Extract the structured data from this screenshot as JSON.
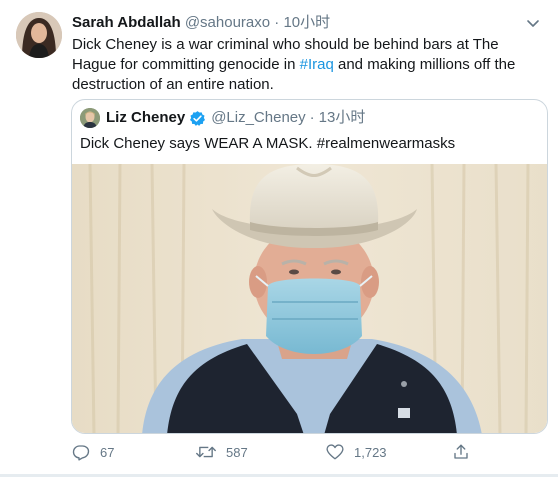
{
  "tweet": {
    "author_name": "Sarah Abdallah",
    "handle": "@sahouraxo",
    "separator": "·",
    "time": "10小时",
    "text_part1": "Dick Cheney is a war criminal who should be behind bars at The Hague for committing genocide in ",
    "hashtag": "#Iraq",
    "text_part2": " and making millions off the destruction of an entire nation.",
    "avatar_icon": "user-avatar-photo",
    "menu_icon": "chevron-down-icon"
  },
  "quoted_tweet": {
    "author_name": "Liz Cheney",
    "handle": "@Liz_Cheney",
    "separator": "·",
    "time": "13小时",
    "text": "Dick Cheney says WEAR A MASK. #realmenwearmasks",
    "verified_icon": "verified-badge-icon",
    "media": "photo of man in white cowboy hat wearing blue face mask"
  },
  "actions": {
    "reply_count": "67",
    "retweet_count": "587",
    "like_count": "1,723",
    "icons": [
      "reply-icon",
      "retweet-icon",
      "like-icon",
      "share-icon"
    ]
  },
  "colors": {
    "link": "#1b95e0",
    "verified": "#1da1f2",
    "secondary_text": "#657786",
    "border": "#ccd6dd"
  }
}
